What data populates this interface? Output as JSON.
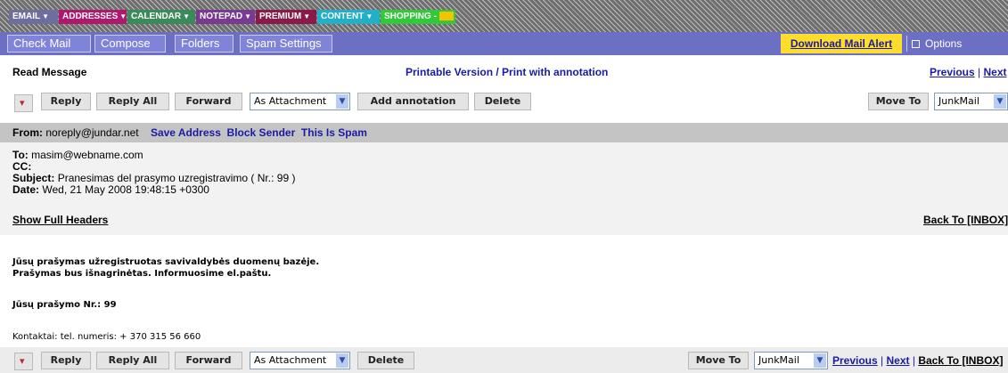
{
  "tabs": [
    {
      "label": "EMAIL",
      "color": "#6e6e9e"
    },
    {
      "label": "ADDRESSES",
      "color": "#b0186e"
    },
    {
      "label": "CALENDAR",
      "color": "#3a8a5a"
    },
    {
      "label": "NOTEPAD",
      "color": "#7a3a92"
    },
    {
      "label": "PREMIUM",
      "color": "#8a1a4a"
    },
    {
      "label": "CONTENT",
      "color": "#22b0c8"
    },
    {
      "label": "SHOPPING -",
      "color": "#31c93a"
    }
  ],
  "nav": {
    "check_mail": "Check Mail",
    "compose": "Compose",
    "folders": "Folders",
    "spam_settings": "Spam Settings",
    "download_alert": "Download Mail Alert",
    "options": "Options"
  },
  "title_row": {
    "title": "Read Message",
    "printable": "Printable Version / Print with annotation",
    "previous": "Previous",
    "sep": "|",
    "next": "Next"
  },
  "toolbar": {
    "reply": "Reply",
    "reply_all": "Reply All",
    "forward": "Forward",
    "forward_mode": "As Attachment",
    "add_annotation": "Add annotation",
    "delete": "Delete",
    "move_to": "Move To",
    "folder": "JunkMail"
  },
  "from": {
    "label": "From:",
    "address": "noreply@jundar.net",
    "save_address": "Save Address",
    "block_sender": "Block Sender",
    "this_is_spam": "This Is Spam"
  },
  "headers": {
    "to_label": "To:",
    "to": "masim@webname.com",
    "cc_label": "CC:",
    "subject_label": "Subject:",
    "subject": "Pranesimas del prasymo uzregistravimo ( Nr.: 99 )",
    "date_label": "Date:",
    "date": "Wed, 21 May 2008 19:48:15 +0300",
    "show_full": "Show Full Headers",
    "back_to": "Back To [INBOX]"
  },
  "message": {
    "line1": "Jūsų prašymas užregistruotas savivaldybės duomenų bazėje.",
    "line2": "Prašymas bus išnagrinėtas. Informuosime el.paštu.",
    "number_line": "Jūsų prašymo Nr.: 99",
    "contacts": "Kontaktai: tel. numeris: + 370 315 56 660"
  },
  "bottom": {
    "reply": "Reply",
    "reply_all": "Reply All",
    "forward": "Forward",
    "forward_mode": "As Attachment",
    "delete": "Delete",
    "move_to": "Move To",
    "folder": "JunkMail",
    "previous": "Previous",
    "sep1": "|",
    "next": "Next",
    "sep2": "|",
    "back_to": "Back To [INBOX]"
  }
}
